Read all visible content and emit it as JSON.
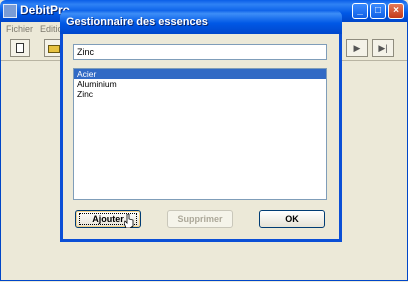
{
  "main_window": {
    "title": "DebitPro",
    "menus": [
      "Fichier",
      "Editio"
    ],
    "nav_buttons": [
      {
        "label": "▶",
        "icon": "play-icon"
      },
      {
        "label": "▶|",
        "icon": "last-icon"
      }
    ]
  },
  "dialog": {
    "title": "Gestionnaire des essences",
    "input_value": "Zinc",
    "list_items": [
      "Acier",
      "Aluminium",
      "Zinc"
    ],
    "selected_index": 0,
    "buttons": {
      "add": "Ajouter",
      "delete": "Supprimer",
      "ok": "OK"
    }
  },
  "colors": {
    "titlebar": "#0058e6",
    "selection": "#316ac5",
    "face": "#ece9d8"
  }
}
